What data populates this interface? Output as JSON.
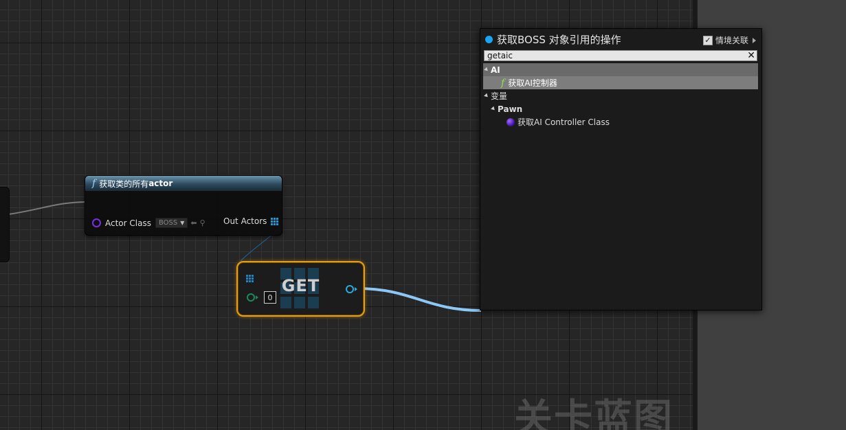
{
  "context_menu": {
    "title": "获取BOSS 对象引用的操作",
    "context_sensitive_label": "情境关联",
    "context_sensitive_checked": true,
    "search_value": "getaic",
    "categories": [
      {
        "label": "AI",
        "items": [
          {
            "label": "获取AI控制器",
            "icon": "function-icon",
            "selected": true
          }
        ]
      },
      {
        "label": "变量",
        "subcategories": [
          {
            "label": "Pawn",
            "items": [
              {
                "label": "获取AI Controller Class",
                "icon": "object-pin-icon",
                "selected": false
              }
            ]
          }
        ]
      }
    ]
  },
  "func_node": {
    "title_prefix": "获取类的所有",
    "title_bold": "actor",
    "actor_class_label": "Actor Class",
    "actor_class_value": "BOSS",
    "out_actors_label": "Out Actors"
  },
  "get_node": {
    "label": "GET",
    "index_value": "0"
  },
  "watermark": "关卡蓝图",
  "colors": {
    "graph_bg": "#262626",
    "menu_bg": "#1b1b1b",
    "selection": "#7d7d7d",
    "accent_blue": "#1ba4f4",
    "object_pin": "#7b2ee6",
    "get_border": "#e8a012",
    "wire": "#8cc8f5"
  }
}
